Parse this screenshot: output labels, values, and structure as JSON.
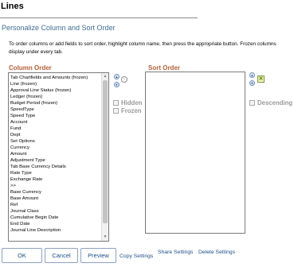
{
  "page": {
    "title": "Lines",
    "subtitle": "Personalize Column and Sort Order",
    "instructions": "To order columns or add fields to sort order, highlight column name, then press the appropriate button. Frozen columns display under every tab."
  },
  "column_order": {
    "header": "Column Order",
    "items": [
      "Tab Chartfields and Amounts (frozen)",
      "Line (frozen)",
      "Approval Line Status (frozen)",
      "Ledger (frozen)",
      "Budget Period (frozen)",
      "SpeedType",
      "Speed Type",
      "Account",
      "Fund",
      "Dept",
      "Set Options",
      "Currency",
      "Amount",
      "Adjustment Type",
      "Tab Base Currency Details",
      "Rate Type",
      "Exchange Rate",
      ">>",
      "Base Currency",
      "Base Amount",
      "Ref",
      "Journal Class",
      "Cumulative Begin Date",
      "End Date",
      "Journal Line Description"
    ],
    "hidden_label": "Hidden",
    "frozen_label": "Frozen"
  },
  "sort_order": {
    "header": "Sort Order",
    "descending_label": "Descending"
  },
  "buttons": {
    "ok": "OK",
    "cancel": "Cancel",
    "preview": "Preview"
  },
  "links": {
    "copy_settings": "Copy Settings",
    "share_settings": "Share Settings",
    "delete_settings": "Delete Settings"
  },
  "icons": {
    "move_up": "arrow-up-icon",
    "move_down": "arrow-down-icon",
    "add_to_sort": "add-to-sort-icon",
    "remove_from_sort": "remove-from-sort-icon"
  },
  "colors": {
    "section_header": "#b3603a",
    "subtitle": "#3f6d94",
    "link": "#1c4e87"
  }
}
